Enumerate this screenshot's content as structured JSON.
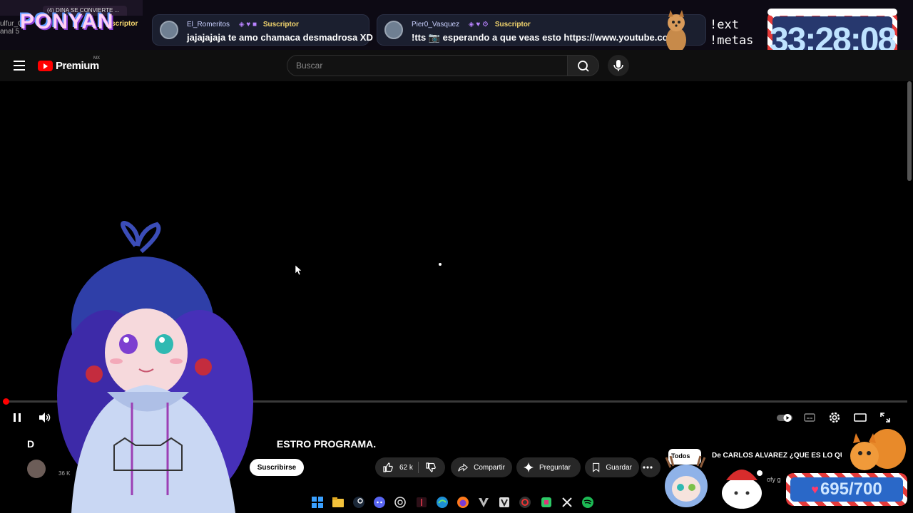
{
  "overlay": {
    "logo_text": "PONYAN",
    "browser_tab_title": "(4) DINA SE CONVIERTE ...",
    "left_partial_user": "ulfur_C",
    "left_partial_msg": "anal 5",
    "left_partial_sub": "uscriptor",
    "chat_messages": [
      {
        "user": "El_Romeritos",
        "badge": "Suscriptor",
        "message": "jajajajaja te amo chamaca desmadrosa XD"
      },
      {
        "user": "Pier0_Vasquez",
        "badge": "Suscriptor",
        "message": "!tts 📷 esperando a que veas esto https://www.youtube.co"
      }
    ],
    "commands": [
      "!ext",
      "!metas"
    ],
    "timer": "33:28:08",
    "goal": {
      "current": 695,
      "total": 700,
      "label": "695/700"
    },
    "colors": {
      "timer_bg": "#27386e",
      "goal_bg": "#2a68c8",
      "stripe_red": "#e43a3a"
    }
  },
  "youtube": {
    "logo_word": "Premium",
    "region": "MX",
    "search_placeholder": "Buscar",
    "video_title_visible_start": "D",
    "video_title_visible_end": "ESTRO PROGRAMA.",
    "subscribers": "36 K",
    "subscribe_label": "Suscribirse",
    "likes": "62 k",
    "share_label": "Compartir",
    "ask_label": "Preguntar",
    "save_label": "Guardar",
    "chip_all": "Todos",
    "related_title": "De CARLOS ALVAREZ ¿QUE ES LO QUE P",
    "related_sub": "ofy g",
    "brand_color": "#ff0000"
  },
  "taskbar": {
    "icons": [
      "windows-icon",
      "folder-icon",
      "steam-icon",
      "discord-icon",
      "chatgpt-icon",
      "app-icon",
      "edge-icon",
      "firefox-icon",
      "vegas-icon",
      "vscode-icon",
      "obs-icon",
      "app2-icon",
      "capcut-icon",
      "spotify-icon"
    ]
  }
}
